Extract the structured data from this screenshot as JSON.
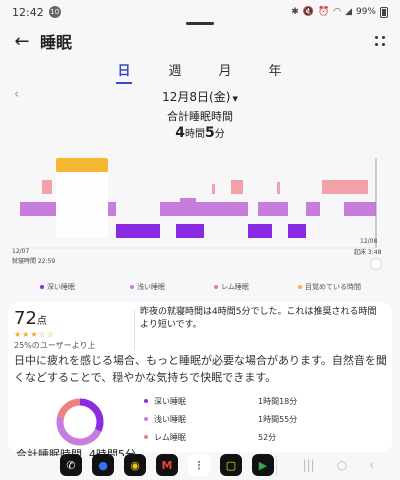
{
  "status_bar": {
    "time": "12:42",
    "notification_count": "10",
    "battery": "99%"
  },
  "header": {
    "title": "睡眠"
  },
  "tabs": [
    {
      "label": "日",
      "active": true
    },
    {
      "label": "週",
      "active": false
    },
    {
      "label": "月",
      "active": false
    },
    {
      "label": "年",
      "active": false
    }
  ],
  "date": {
    "label": "12月8日(金)"
  },
  "total_sleep": {
    "label": "合計睡眠時間",
    "hours": "4",
    "hours_unit": "時間",
    "minutes": "5",
    "minutes_unit": "分"
  },
  "chart": {
    "start_date": "12/07",
    "start_label": "就寝時間 22:59",
    "end_date": "12/08",
    "end_label": "起床 3:48"
  },
  "legend": [
    {
      "label": "深い睡眠",
      "color": "#8a2be2"
    },
    {
      "label": "浅い睡眠",
      "color": "#c77ddb"
    },
    {
      "label": "レム睡眠",
      "color": "#f08080"
    },
    {
      "label": "目覚めている時間",
      "color": "#f5b731"
    }
  ],
  "card": {
    "score": "72",
    "score_unit": "点",
    "stars": "★★★☆☆",
    "percentile": "25%のユーザーより上",
    "summary": "昨夜の就寝時間は4時間5分でした。これは推奨される時間より短いです。",
    "advice": "日中に疲れを感じる場合、もっと睡眠が必要な場合があります。自然音を聞くなどすることで、穏やかな気持ちで快眠できます。",
    "stages": [
      {
        "label": "深い睡眠",
        "duration": "1時間18分",
        "color": "#8a2be2",
        "minutes": 78
      },
      {
        "label": "浅い睡眠",
        "duration": "1時間55分",
        "color": "#c77ddb",
        "minutes": 115
      },
      {
        "label": "レム睡眠",
        "duration": "52分",
        "color": "#f08080",
        "minutes": 52
      }
    ],
    "total_label": "合計睡眠時間",
    "total_value": "4時間5分"
  },
  "colors": {
    "accent": "#3b49c9",
    "deep": "#8a2be2",
    "light": "#c77ddb",
    "rem": "#f08080",
    "awake": "#f5b731"
  }
}
